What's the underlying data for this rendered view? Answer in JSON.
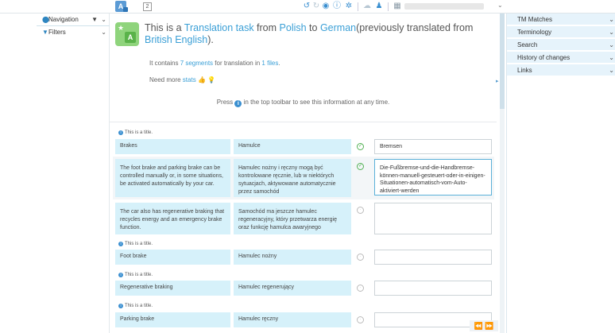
{
  "toolbar": {
    "logo_label": "A",
    "segment_number": "2",
    "icons": [
      "undo-icon",
      "redo-icon",
      "preview-icon",
      "info-icon",
      "settings-icon",
      "cloud-icon",
      "user-plus-icon",
      "grid-icon"
    ],
    "user_caret": "⌄"
  },
  "left_panel": {
    "navigation_label": "Navigation",
    "filters_label": "Filters"
  },
  "header": {
    "prefix": "This is a ",
    "task_link": "Translation task",
    "from": " from ",
    "source_lang": "Polish",
    "to": " to ",
    "target_lang": "German",
    "prev": "(previously translated from ",
    "prev_lang": "British English",
    "suffix": ").",
    "icon_letter": "A",
    "segments_text_1": "It contains ",
    "segments_count": "7 segments",
    "segments_text_2": " for translation in ",
    "files_count": "1 files",
    "segments_text_3": ".",
    "need_more": "Need more ",
    "stats_link": "stats",
    "press_1": "Press ",
    "press_icon": "i",
    "press_2": " in the top toolbar to see this information at any time."
  },
  "segments": [
    {
      "note": "This is a title.",
      "source": "Brakes",
      "mt": "Hamulce",
      "status": "confirmed",
      "target": "Bremsen"
    },
    {
      "note": "",
      "source": "The foot brake and parking brake can be controlled manually or, in some situations, be activated automatically by your car.",
      "mt": "Hamulec nożny i ręczny mogą być kontrolowane ręcznie, lub w niektórych sytuacjach, aktywowane automatycznie przez samochód",
      "status": "confirmed",
      "target": "Die-Fußbremse-und-die-Handbremse-können-manuell-gesteuert-oder-in-einigen-Situationen-automatisch-vom-Auto-aktiviert-werden"
    },
    {
      "note": "",
      "source": "The car also has regenerative braking that recycles energy and an emergency brake function.",
      "mt": "Samochód ma jeszcze hamulec regeneracyjny, który przetwarza energię oraz funkcję hamulca awaryjnego",
      "status": "pending",
      "target": ""
    },
    {
      "note": "This is a title.",
      "source": "Foot brake",
      "mt": "Hamulec nożny",
      "status": "pending",
      "target": ""
    },
    {
      "note": "This is a title.",
      "source": "Regenerative braking",
      "mt": "Hamulec regenerujący",
      "status": "pending",
      "target": ""
    },
    {
      "note": "This is a title.",
      "source": "Parking brake",
      "mt": "Hamulec ręczny",
      "status": "pending",
      "target": ""
    }
  ],
  "right_panel": {
    "items": [
      "TM Matches",
      "Terminology",
      "Search",
      "History of changes",
      "Links"
    ]
  },
  "colors": {
    "accent": "#3a9fd6",
    "panel": "#e6f3fb",
    "source_bg": "#d6f1fa",
    "confirmed": "#53b155"
  }
}
